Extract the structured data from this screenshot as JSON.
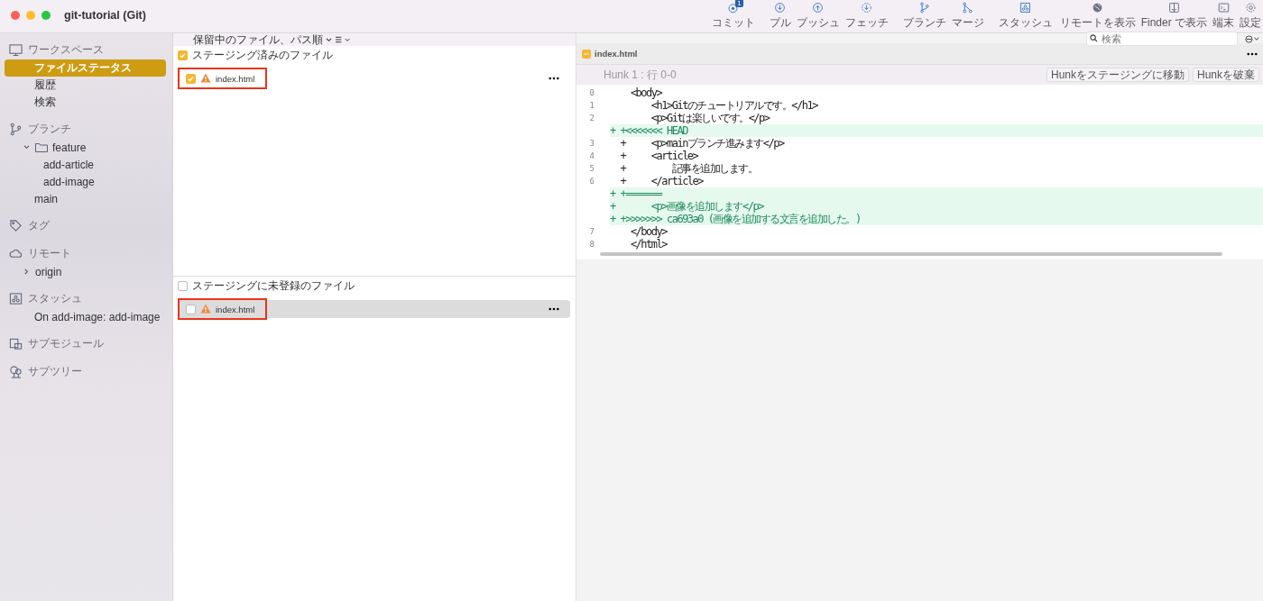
{
  "window": {
    "title": "git-tutorial (Git)"
  },
  "toolbar": [
    {
      "label": "コミット",
      "kind": "commit",
      "badge": "1"
    },
    {
      "label": "プル",
      "kind": "pull"
    },
    {
      "label": "プッシュ",
      "kind": "push"
    },
    {
      "label": "フェッチ",
      "kind": "fetch"
    },
    {
      "label": "ブランチ",
      "kind": "branch"
    },
    {
      "label": "マージ",
      "kind": "merge"
    },
    {
      "label": "スタッシュ",
      "kind": "stash"
    },
    {
      "label": "リモートを表示",
      "kind": "remote"
    },
    {
      "label": "Finder で表示",
      "kind": "finder"
    },
    {
      "label": "端末",
      "kind": "terminal"
    },
    {
      "label": "設定",
      "kind": "settings"
    }
  ],
  "search": {
    "placeholder": "検索"
  },
  "sidebar": [
    {
      "title": "ワークスペース",
      "kind": "workspace",
      "items": [
        {
          "label": "ファイルステータス",
          "selected": true
        },
        {
          "label": "履歴",
          "selected": false
        },
        {
          "label": "検索",
          "selected": false
        }
      ]
    },
    {
      "title": "ブランチ",
      "kind": "branches",
      "items": [
        {
          "label": "feature",
          "folder": true,
          "expanded": true,
          "selected": false,
          "children": [
            {
              "label": "add-article",
              "selected": false
            },
            {
              "label": "add-image",
              "selected": false
            }
          ]
        },
        {
          "label": "main",
          "selected": false
        }
      ]
    },
    {
      "title": "タグ",
      "kind": "tags"
    },
    {
      "title": "リモート",
      "kind": "remotes",
      "items": [
        {
          "label": "origin",
          "expanded": false,
          "selected": false
        }
      ]
    },
    {
      "title": "スタッシュ",
      "kind": "stashes",
      "items": [
        {
          "label": "On add-image: add-image",
          "selected": false
        }
      ]
    },
    {
      "title": "サブモジュール",
      "kind": "submodules"
    },
    {
      "title": "サブツリー",
      "kind": "subtrees"
    }
  ],
  "file_filter": {
    "sort": "保留中のファイル、パス順"
  },
  "staged": {
    "title": "ステージング済みのファイル",
    "checked": true,
    "files": [
      {
        "name": "index.html",
        "checked": true,
        "selected": false,
        "highlighted": true
      }
    ]
  },
  "unstaged": {
    "title": "ステージングに未登録のファイル",
    "checked": false,
    "files": [
      {
        "name": "index.html",
        "checked": false,
        "selected": true,
        "highlighted": true
      }
    ]
  },
  "diff": {
    "file": "index.html",
    "hunk": "Hunk 1 : 行 0-0",
    "buttons": [
      "Hunkをステージングに移動",
      "Hunkを破棄"
    ],
    "lines": [
      {
        "number": "0",
        "text": "    <body>",
        "added": false
      },
      {
        "number": "1",
        "text": "        <h1>Gitのチュートリアルです。</h1>",
        "added": false
      },
      {
        "number": "2",
        "text": "        <p>Gitは楽しいです。</p>",
        "added": false
      },
      {
        "text": "+ +<<<<<<< HEAD",
        "added": true
      },
      {
        "number": "3",
        "text": "  +     <p>mainブランチ進みます</p>",
        "added": false
      },
      {
        "number": "4",
        "text": "  +     <article>",
        "added": false
      },
      {
        "number": "5",
        "text": "  +         記事を追加します。",
        "added": false
      },
      {
        "number": "6",
        "text": "  +     </article>",
        "added": false
      },
      {
        "text": "+ +=======",
        "added": true
      },
      {
        "text": "+       <p>画像を追加します</p>",
        "added": true
      },
      {
        "text": "+ +>>>>>>> ca693a0 (画像を追加する文言を追加した。)",
        "added": true
      },
      {
        "number": "7",
        "text": "    </body>",
        "added": false
      },
      {
        "number": "8",
        "text": "    </html>",
        "added": false
      }
    ]
  }
}
